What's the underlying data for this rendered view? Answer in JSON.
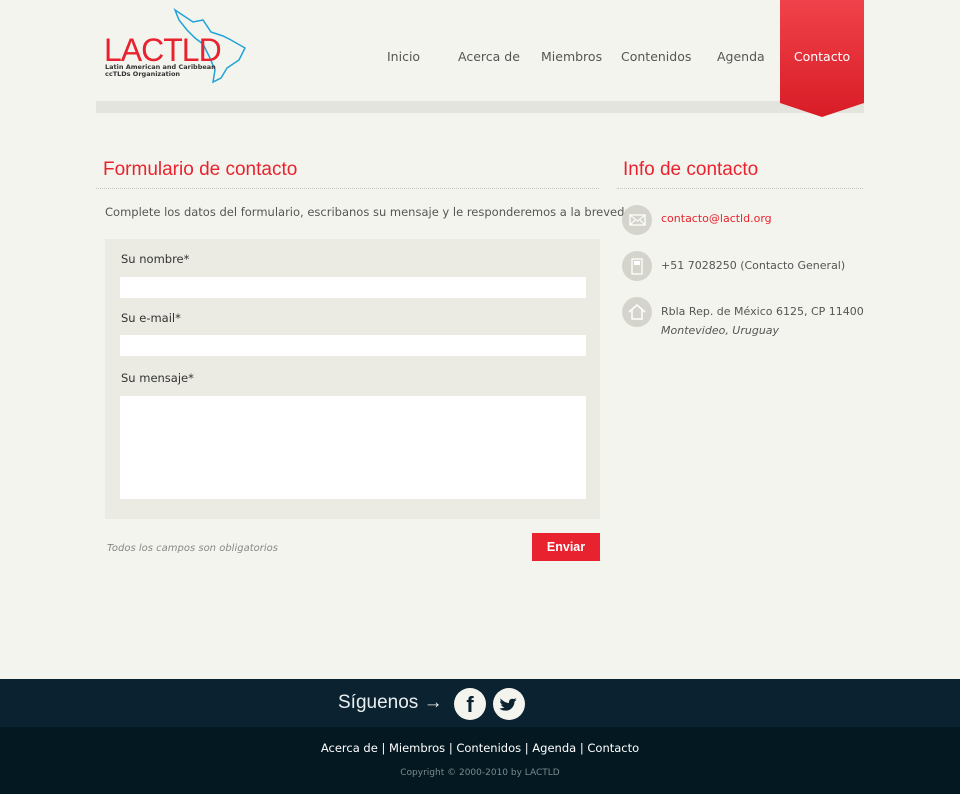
{
  "logo": {
    "name": "LACTLD",
    "subtitle_1": "Latin American and Caribbean",
    "subtitle_2": "ccTLDs Organization"
  },
  "nav": [
    "Inicio",
    "Acerca de",
    "Miembros",
    "Contenidos",
    "Agenda",
    "Contacto"
  ],
  "form": {
    "title": "Formulario de contacto",
    "intro": "Complete los datos del formulario, escribanos su mensaje y le responderemos a la brevedad.",
    "name_label": "Su nombre*",
    "email_label": "Su e-mail*",
    "message_label": "Su mensaje*",
    "note": "Todos los campos son obligatorios",
    "submit": "Enviar"
  },
  "info": {
    "title": "Info de contacto",
    "email": "contacto@lactld.org",
    "phone": "+51 7028250 (Contacto General)",
    "address": "Rbla Rep. de México 6125, CP 11400",
    "city": "Montevideo, Uruguay"
  },
  "footer": {
    "follow": "Síguenos",
    "arrow": "→",
    "facebook": "f",
    "links": [
      "Acerca de ",
      "Miembros",
      "Contenidos",
      "Agenda",
      "Contacto"
    ],
    "sep": "|",
    "copyright": "Copyright © 2000-2010 by LACTLD"
  },
  "colors": {
    "accent": "#e8232f",
    "footer": "#0b2230"
  }
}
